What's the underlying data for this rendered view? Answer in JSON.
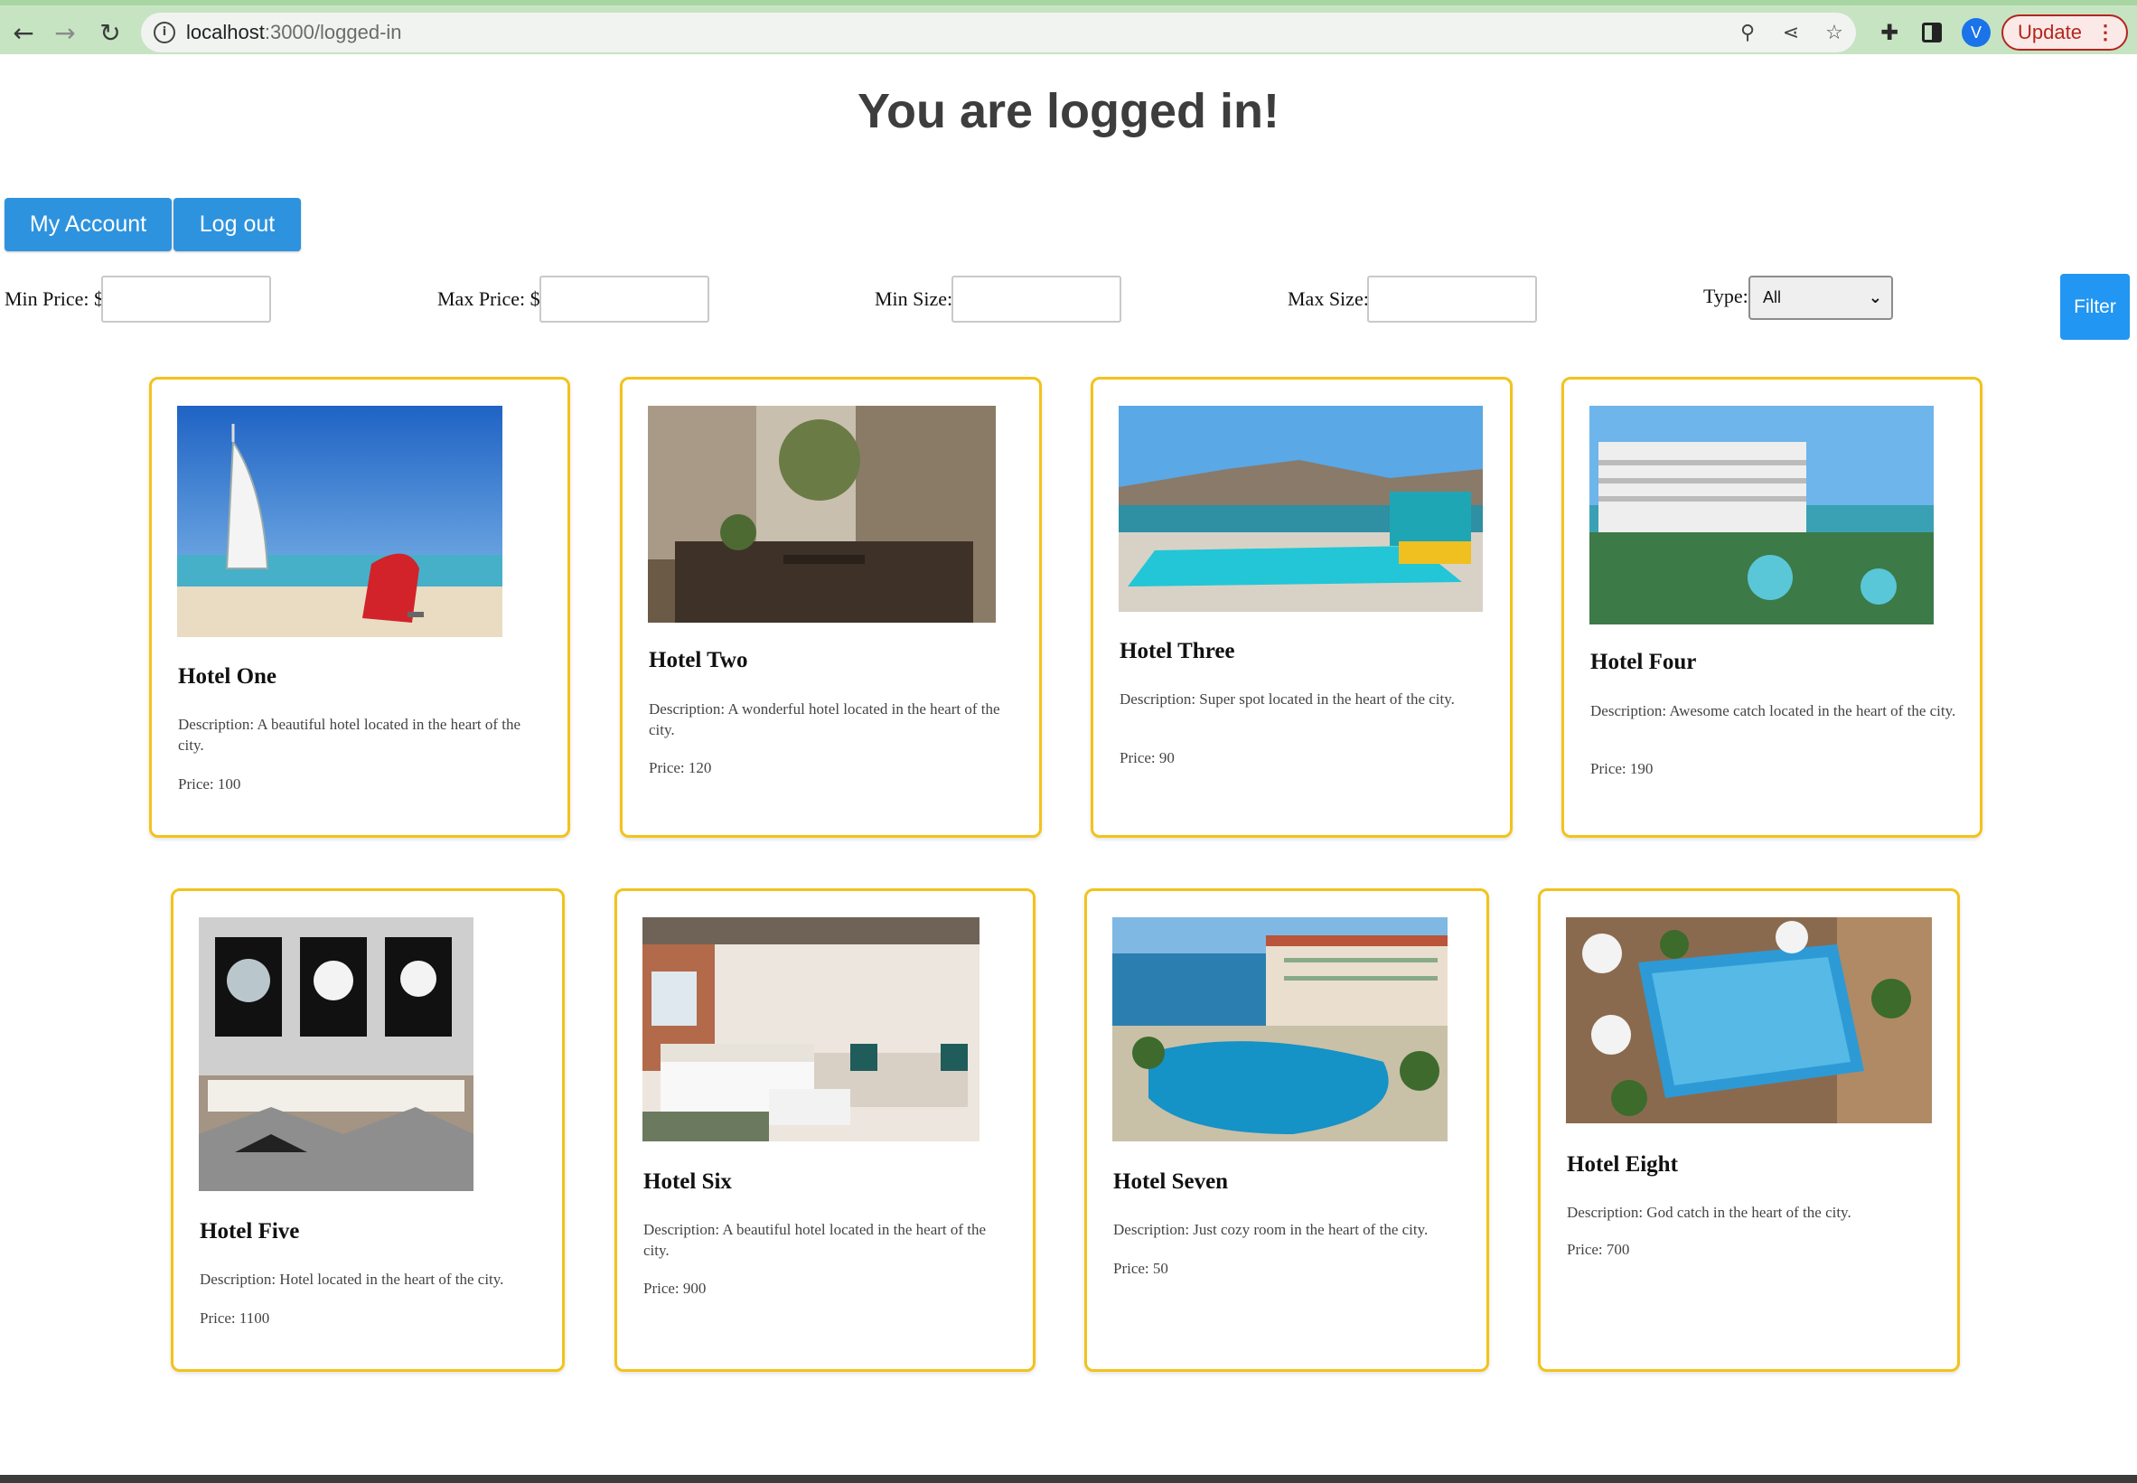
{
  "browser": {
    "url_host": "localhost",
    "url_path": ":3000/logged-in",
    "avatar_letter": "V",
    "update_label": "Update"
  },
  "page": {
    "title": "You are logged in!",
    "my_account_label": "My Account",
    "logout_label": "Log out"
  },
  "filters": {
    "min_price_label": "Min Price: $",
    "max_price_label": "Max Price: $",
    "min_size_label": "Min Size:",
    "max_size_label": "Max Size:",
    "type_label": "Type:",
    "type_value": "All",
    "filter_button": "Filter",
    "min_price_value": "",
    "max_price_value": "",
    "min_size_value": "",
    "max_size_value": ""
  },
  "hotels": [
    {
      "name": "Hotel One",
      "description": "Description: A beautiful hotel located in the heart of the city.",
      "price": "Price: 100",
      "photo": "burj-al-arab-beach"
    },
    {
      "name": "Hotel Two",
      "description": "Description: A wonderful hotel located in the heart of the city.",
      "price": "Price: 120",
      "photo": "city-rooftop-terrace"
    },
    {
      "name": "Hotel Three",
      "description": "Description: Super spot located in the heart of the city.",
      "price": "Price: 90",
      "photo": "resort-pool-mountains"
    },
    {
      "name": "Hotel Four",
      "description": "Description: Awesome catch located in the heart of the city.",
      "price": "Price: 190",
      "photo": "beachfront-resort-aerial"
    },
    {
      "name": "Hotel Five",
      "description": "Description: Hotel located in the heart of the city.",
      "price": "Price: 1100",
      "photo": "bedroom-floral-art"
    },
    {
      "name": "Hotel Six",
      "description": "Description: A beautiful hotel located in the heart of the city.",
      "price": "Price: 900",
      "photo": "loft-suite-bedroom"
    },
    {
      "name": "Hotel Seven",
      "description": "Description: Just cozy room in the heart of the city.",
      "price": "Price: 50",
      "photo": "seaside-resort-pool"
    },
    {
      "name": "Hotel Eight",
      "description": "Description: God catch in the heart of the city.",
      "price": "Price: 700",
      "photo": "courtyard-pool-aerial"
    }
  ],
  "colors": {
    "accent_blue": "#2e93de",
    "card_border": "#f2c31a",
    "chrome_green": "#c6e4c2"
  }
}
